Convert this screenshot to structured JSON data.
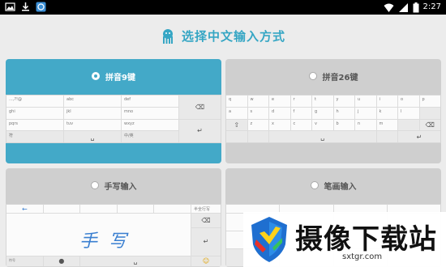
{
  "status_bar": {
    "time": "2:27"
  },
  "page": {
    "title": "选择中文输入方式"
  },
  "options": [
    {
      "label": "拼音9键",
      "selected": true
    },
    {
      "label": "拼音26键",
      "selected": false
    },
    {
      "label": "手写输入",
      "selected": false
    },
    {
      "label": "笔画输入",
      "selected": false
    }
  ],
  "nine_key": {
    "keys": [
      "...,?!@",
      "abc",
      "def",
      "ghi",
      "jkl",
      "mno",
      "pqrs",
      "tuv",
      "wxyz",
      "符",
      "",
      "中/英"
    ]
  },
  "twentysix_key": {
    "row1": [
      "q",
      "w",
      "e",
      "r",
      "t",
      "y",
      "u",
      "i",
      "o",
      "p"
    ],
    "row2": [
      "a",
      "s",
      "d",
      "f",
      "g",
      "h",
      "j",
      "k",
      "l"
    ],
    "row3": [
      "z",
      "x",
      "c",
      "v",
      "b",
      "n",
      "m"
    ]
  },
  "handwriting": {
    "sample_text": "手写",
    "mode_label": "半全行写",
    "sym_label": "符号"
  },
  "watermark": {
    "brand": "摄像下载站",
    "domain": "sxtgr.com"
  },
  "colors": {
    "accent": "#43a9c8",
    "heading": "#35a6c4",
    "status_bar": "#000000"
  }
}
